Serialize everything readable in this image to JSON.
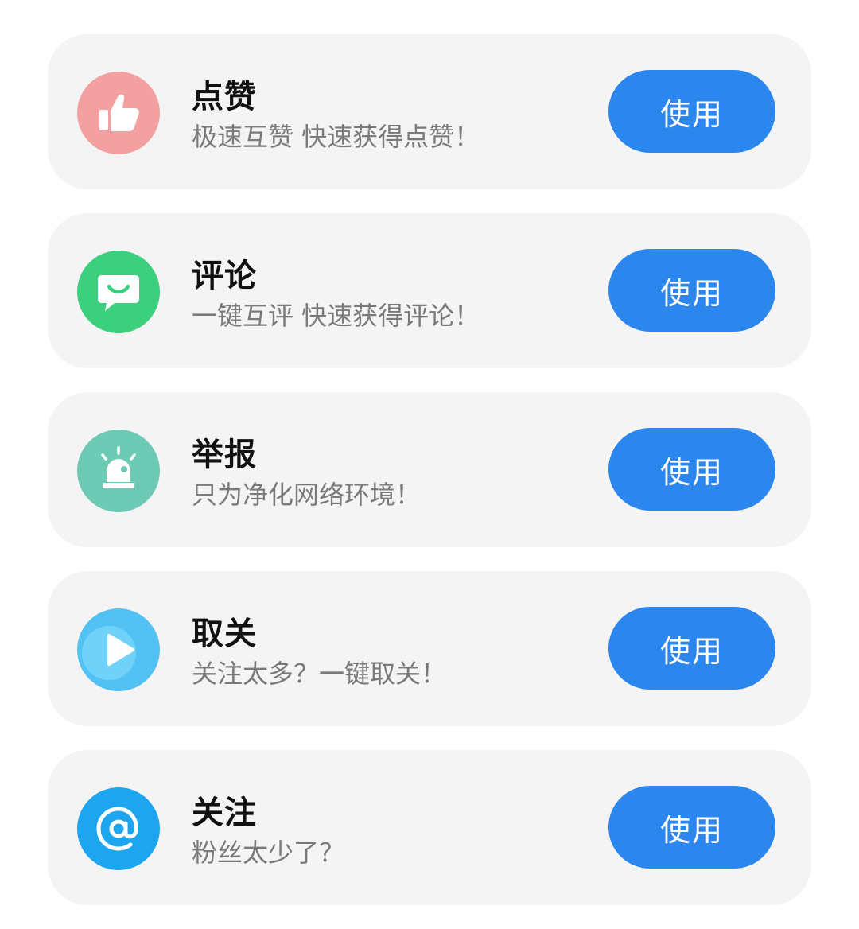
{
  "items": [
    {
      "title": "点赞",
      "subtitle": "极速互赞 快速获得点赞！",
      "button_label": "使用",
      "icon": "thumbs-up-icon",
      "icon_color": "#f5a0a0"
    },
    {
      "title": "评论",
      "subtitle": "一键互评 快速获得评论！",
      "button_label": "使用",
      "icon": "comment-bubble-icon",
      "icon_color": "#3ccf7e"
    },
    {
      "title": "举报",
      "subtitle": "只为净化网络环境！",
      "button_label": "使用",
      "icon": "alarm-siren-icon",
      "icon_color": "#6ccab5"
    },
    {
      "title": "取关",
      "subtitle": "关注太多？一键取关！",
      "button_label": "使用",
      "icon": "play-icon",
      "icon_color": "#52c2f5"
    },
    {
      "title": "关注",
      "subtitle": "粉丝太少了？",
      "button_label": "使用",
      "icon": "at-sign-icon",
      "icon_color": "#1da5f0"
    }
  ],
  "colors": {
    "button": "#2b86ee",
    "card_background": "#f4f4f4"
  }
}
